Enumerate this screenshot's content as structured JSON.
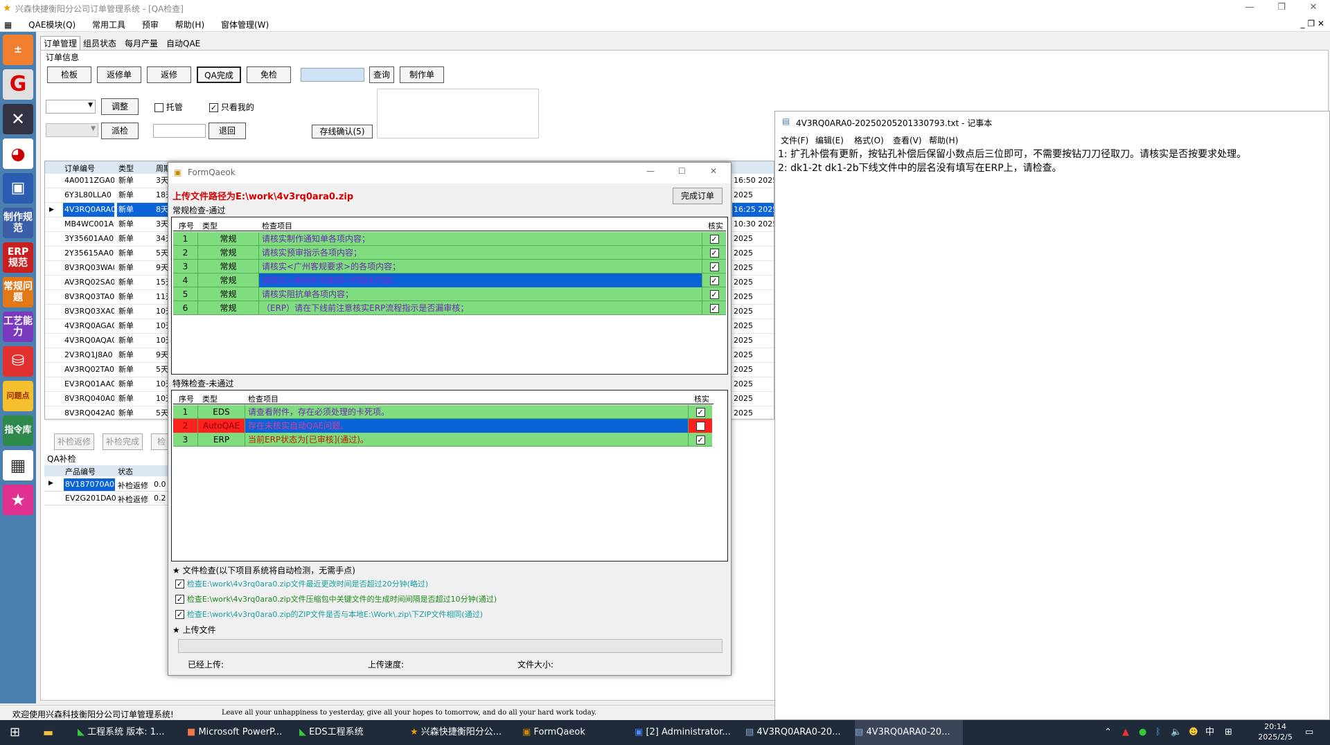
{
  "app": {
    "title": "兴森快捷衡阳分公司订单管理系统 - [QA检查]",
    "menu": [
      "QAE模块(Q)",
      "常用工具",
      "预审",
      "帮助(H)",
      "窗体管理(W)"
    ],
    "tabs": [
      "订单管理",
      "组员状态",
      "每月产量",
      "自动QAE"
    ],
    "section_title": "订单信息",
    "buttons": {
      "jianban": "检板",
      "fanxiudan": "返修单",
      "fanxiu": "返修",
      "qa_done": "QA完成",
      "mianjian": "免检",
      "query": "查询",
      "make_order": "制作单",
      "adjust": "调整",
      "dispatch": "派检",
      "return": "退回",
      "online_confirm": "存线确认(5)"
    },
    "checkboxes": {
      "tuoguan": "托管",
      "only_mine": "只看我的"
    },
    "grid": {
      "headers": [
        "订单编号",
        "类型",
        "周期"
      ],
      "rows": [
        {
          "id": "4A0011ZGA0",
          "type": "新单",
          "cycle": "3天"
        },
        {
          "id": "6Y3L80LLA0",
          "type": "新单",
          "cycle": "18天"
        },
        {
          "id": "4V3RQ0ARA0",
          "type": "新单",
          "cycle": "8天"
        },
        {
          "id": "MB4WC001A0",
          "type": "新单",
          "cycle": "3天"
        },
        {
          "id": "3Y35601AA0",
          "type": "新单",
          "cycle": "34天"
        },
        {
          "id": "2Y35615AA0",
          "type": "新单",
          "cycle": "5天"
        },
        {
          "id": "8V3RQ03WA0",
          "type": "新单",
          "cycle": "9天"
        },
        {
          "id": "AV3RQ02SA0",
          "type": "新单",
          "cycle": "15天"
        },
        {
          "id": "8V3RQ03TA0",
          "type": "新单",
          "cycle": "11天"
        },
        {
          "id": "8V3RQ03XA0",
          "type": "新单",
          "cycle": "10天"
        },
        {
          "id": "4V3RQ0AGA0",
          "type": "新单",
          "cycle": "10天"
        },
        {
          "id": "4V3RQ0AQA0",
          "type": "新单",
          "cycle": "10天"
        },
        {
          "id": "2V3RQ1J8A0",
          "type": "新单",
          "cycle": "9天"
        },
        {
          "id": "AV3RQ02TA0",
          "type": "新单",
          "cycle": "5天"
        },
        {
          "id": "EV3RQ01AA0",
          "type": "新单",
          "cycle": "10天"
        },
        {
          "id": "8V3RQ040A0",
          "type": "新单",
          "cycle": "10天"
        },
        {
          "id": "8V3RQ042A0",
          "type": "新单",
          "cycle": "5天"
        }
      ],
      "right_col": [
        {
          "time": "16:50",
          "year": "2025"
        },
        {
          "time": "",
          "year": "2025"
        },
        {
          "time": "16:25",
          "year": "2025"
        },
        {
          "time": "10:30",
          "year": "2025"
        },
        {
          "time": "",
          "year": "2025"
        },
        {
          "time": "",
          "year": "2025"
        },
        {
          "time": "",
          "year": "2025"
        },
        {
          "time": "",
          "year": "2025"
        },
        {
          "time": "",
          "year": "2025"
        },
        {
          "time": "",
          "year": "2025"
        },
        {
          "time": "",
          "year": "2025"
        },
        {
          "time": "",
          "year": "2025"
        },
        {
          "time": "",
          "year": "2025"
        },
        {
          "time": "",
          "year": "2025"
        },
        {
          "time": "",
          "year": "2025"
        },
        {
          "time": "",
          "year": "2025"
        },
        {
          "time": "",
          "year": "2025"
        }
      ]
    },
    "bottom_buttons": [
      "补检返修",
      "补检完成",
      "检"
    ],
    "qa_supp": {
      "title": "QA补检",
      "headers": [
        "产品编号",
        "状态"
      ],
      "rows": [
        {
          "id": "8V187070A0",
          "status": "补检返修",
          "val": "0.0"
        },
        {
          "id": "EV2G201DA0",
          "status": "补检返修",
          "val": "0.2"
        }
      ]
    },
    "status_left": "欢迎使用兴森科技衡阳分公司订单管理系统!",
    "status_right": "Leave all your unhappiness to yesterday, give all your hopes to tomorrow, and do all your hard work today."
  },
  "dialog": {
    "title": "FormQaeok",
    "upload_path": "上传文件路径为E:\\work\\4v3rq0ara0.zip",
    "complete_button": "完成订单",
    "regular_title": "常规检查-通过",
    "regular_headers": [
      "序号",
      "类型",
      "检查项目",
      "核实"
    ],
    "regular_rows": [
      {
        "no": "1",
        "type": "常规",
        "item": "请核实制作通知单各项内容；"
      },
      {
        "no": "2",
        "type": "常规",
        "item": "请核实预审指示各项内容；"
      },
      {
        "no": "3",
        "type": "常规",
        "item": "请核实<广州客规要求>的各项内容；"
      },
      {
        "no": "4",
        "type": "常规",
        "item": "请核实<衡阳补充客规>的相关内容；"
      },
      {
        "no": "5",
        "type": "常规",
        "item": "请核实阻抗单各项内容；"
      },
      {
        "no": "6",
        "type": "常规",
        "item": "（ERP）请在下线前注意核实ERP流程指示是否漏审核；"
      }
    ],
    "special_title": "特殊检查-未通过",
    "special_headers": [
      "序号",
      "类型",
      "检查项目",
      "核实"
    ],
    "special_rows": [
      {
        "no": "1",
        "type": "EDS",
        "item": "请查看附件，存在必须处理的卡死项。"
      },
      {
        "no": "2",
        "type": "AutoQAE",
        "item": "存在未核实自动QAE问题。"
      },
      {
        "no": "3",
        "type": "ERP",
        "item": "当前ERP状态为[已审核](通过)。"
      }
    ],
    "file_check_title": "★ 文件检查(以下项目系统将自动检测，无需手点)",
    "file_checks": [
      "检查E:\\work\\4v3rq0ara0.zip文件最近更改时间是否超过20分钟(略过)",
      "检查E:\\work\\4v3rq0ara0.zip文件压缩包中关键文件的生成时间间隔是否超过10分钟(通过)",
      "检查E:\\work\\4v3rq0ara0.zip的ZIP文件是否与本地E:\\Work\\.zip\\下ZIP文件相同(通过)"
    ],
    "upload_title": "★ 上传文件",
    "uploaded_label": "已经上传:",
    "speed_label": "上传速度:",
    "size_label": "文件大小:"
  },
  "notepad": {
    "title": "4V3RQ0ARA0-20250205201330793.txt - 记事本",
    "menu": [
      "文件(F)",
      "编辑(E)",
      "格式(O)",
      "查看(V)",
      "帮助(H)"
    ],
    "lines": [
      "1: 扩孔补偿有更新，按钻孔补偿后保留小数点后三位即可，不需要按钻刀刀径取刀。请核实是否按要求处理。",
      "2: dk1-2t dk1-2b下线文件中的层名没有填写在ERP上，请检查。"
    ]
  },
  "taskbar": {
    "items": [
      "工程系统 版本: 1...",
      "Microsoft PowerP...",
      "EDS工程系统",
      "兴森快捷衡阳分公...",
      "FormQaeok",
      "[2] Administrator...",
      "4V3RQ0ARA0-20...",
      "4V3RQ0ARA0-20..."
    ],
    "ime": "中",
    "time": "20:14",
    "date": "2025/2/5"
  },
  "left_toolbar": [
    "制作规范",
    "ERP规范",
    "常规问题",
    "工艺能力",
    "问题点",
    "指令库"
  ],
  "colors": {
    "pass_green": "#7fdc7f",
    "select_blue": "#0a64d8",
    "fail_red": "#ff2020",
    "path_red": "#d40000"
  }
}
